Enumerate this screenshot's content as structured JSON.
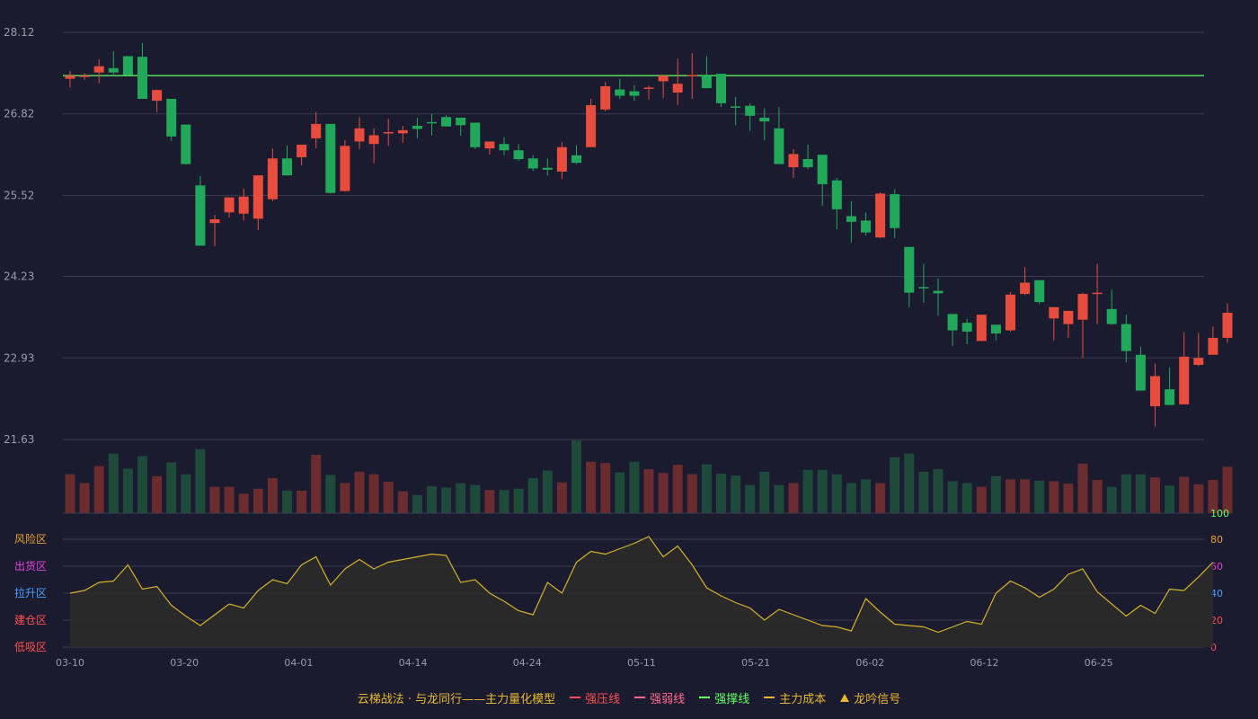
{
  "chart_data": [
    {
      "type": "candlestick",
      "y_axis_ticks": [
        "28.12",
        "26.82",
        "25.52",
        "24.23",
        "22.93",
        "21.63"
      ],
      "ylim": [
        21.63,
        28.12
      ],
      "resistance_line": 27.43,
      "date_ticks": [
        "03-10",
        "03-20",
        "04-01",
        "04-14",
        "04-24",
        "05-11",
        "05-21",
        "06-02",
        "06-12",
        "06-25"
      ],
      "ohlc": [
        [
          27.38,
          27.5,
          27.24,
          27.43
        ],
        [
          27.43,
          27.47,
          27.36,
          27.43
        ],
        [
          27.48,
          27.69,
          27.31,
          27.58
        ],
        [
          27.55,
          27.82,
          27.43,
          27.48
        ],
        [
          27.74,
          27.74,
          27.43,
          27.44
        ],
        [
          27.73,
          27.95,
          27.07,
          27.06
        ],
        [
          27.03,
          27.21,
          26.85,
          27.2
        ],
        [
          27.06,
          27.06,
          26.39,
          26.46
        ],
        [
          26.65,
          26.65,
          26.01,
          26.02
        ],
        [
          25.68,
          25.83,
          24.77,
          24.72
        ],
        [
          25.08,
          25.21,
          24.71,
          25.14
        ],
        [
          25.25,
          25.49,
          25.17,
          25.49
        ],
        [
          25.23,
          25.63,
          25.12,
          25.5
        ],
        [
          25.15,
          25.84,
          24.97,
          25.84
        ],
        [
          25.46,
          26.27,
          25.43,
          26.11
        ],
        [
          26.11,
          26.32,
          25.89,
          25.84
        ],
        [
          26.13,
          26.31,
          26.0,
          26.33
        ],
        [
          26.43,
          26.85,
          26.27,
          26.66
        ],
        [
          26.66,
          26.65,
          25.55,
          25.56
        ],
        [
          25.59,
          26.4,
          25.58,
          26.31
        ],
        [
          26.38,
          26.77,
          26.26,
          26.59
        ],
        [
          26.34,
          26.59,
          26.03,
          26.48
        ],
        [
          26.53,
          26.74,
          26.31,
          26.53
        ],
        [
          26.51,
          26.63,
          26.36,
          26.56
        ],
        [
          26.63,
          26.76,
          26.43,
          26.58
        ],
        [
          26.69,
          26.82,
          26.48,
          26.67
        ],
        [
          26.77,
          26.8,
          26.63,
          26.62
        ],
        [
          26.76,
          26.69,
          26.47,
          26.64
        ],
        [
          26.68,
          26.66,
          26.26,
          26.29
        ],
        [
          26.27,
          26.38,
          26.17,
          26.38
        ],
        [
          26.34,
          26.45,
          26.16,
          26.24
        ],
        [
          26.24,
          26.34,
          26.07,
          26.1
        ],
        [
          26.11,
          26.16,
          25.91,
          25.95
        ],
        [
          25.96,
          26.11,
          25.84,
          25.93
        ],
        [
          25.9,
          26.37,
          25.78,
          26.29
        ],
        [
          26.16,
          26.32,
          26.02,
          26.04
        ],
        [
          26.29,
          27.06,
          26.32,
          26.96
        ],
        [
          26.89,
          27.33,
          26.86,
          27.26
        ],
        [
          27.21,
          27.38,
          27.06,
          27.11
        ],
        [
          27.18,
          27.28,
          27.03,
          27.11
        ],
        [
          27.24,
          27.27,
          27.05,
          27.24
        ],
        [
          27.34,
          27.4,
          27.07,
          27.43
        ],
        [
          27.16,
          27.7,
          26.96,
          27.3
        ],
        [
          27.44,
          27.79,
          27.06,
          27.44
        ],
        [
          27.43,
          27.74,
          27.39,
          27.23
        ],
        [
          27.46,
          27.46,
          26.93,
          26.99
        ],
        [
          26.94,
          27.09,
          26.64,
          26.92
        ],
        [
          26.95,
          26.99,
          26.55,
          26.79
        ],
        [
          26.76,
          26.91,
          26.4,
          26.7
        ],
        [
          26.59,
          26.93,
          26.23,
          26.02
        ],
        [
          25.97,
          26.26,
          25.8,
          26.18
        ],
        [
          26.1,
          26.33,
          25.94,
          25.97
        ],
        [
          26.17,
          26.06,
          25.35,
          25.7
        ],
        [
          25.76,
          25.8,
          24.98,
          25.3
        ],
        [
          25.19,
          25.43,
          24.77,
          25.1
        ],
        [
          25.12,
          25.25,
          24.88,
          24.93
        ],
        [
          24.85,
          25.57,
          24.84,
          25.55
        ],
        [
          25.54,
          25.62,
          24.84,
          25.0
        ],
        [
          24.7,
          24.44,
          23.74,
          23.97
        ],
        [
          24.06,
          24.43,
          23.81,
          24.04
        ],
        [
          24.0,
          24.2,
          23.6,
          23.96
        ],
        [
          23.63,
          23.59,
          23.12,
          23.37
        ],
        [
          23.49,
          23.55,
          23.15,
          23.35
        ],
        [
          23.2,
          23.53,
          23.25,
          23.62
        ],
        [
          23.46,
          23.41,
          23.21,
          23.32
        ],
        [
          23.37,
          23.98,
          23.35,
          23.94
        ],
        [
          23.95,
          24.38,
          23.93,
          24.13
        ],
        [
          24.17,
          24.13,
          23.79,
          23.82
        ],
        [
          23.56,
          23.73,
          23.21,
          23.74
        ],
        [
          23.47,
          23.68,
          23.25,
          23.68
        ],
        [
          23.54,
          23.97,
          22.93,
          23.95
        ],
        [
          23.97,
          24.43,
          23.47,
          23.97
        ],
        [
          23.71,
          24.02,
          23.46,
          23.47
        ],
        [
          23.47,
          23.62,
          22.86,
          23.04
        ],
        [
          22.98,
          23.11,
          22.41,
          22.41
        ],
        [
          22.16,
          22.84,
          21.84,
          22.64
        ],
        [
          22.43,
          22.78,
          22.2,
          22.18
        ],
        [
          22.19,
          23.34,
          22.19,
          22.95
        ],
        [
          22.82,
          23.33,
          22.8,
          22.93
        ],
        [
          22.98,
          23.43,
          22.99,
          23.25
        ],
        [
          23.25,
          23.8,
          23.17,
          23.65
        ]
      ],
      "volume": [
        62,
        48,
        75,
        95,
        71,
        91,
        59,
        81,
        62,
        102,
        42,
        42,
        31,
        39,
        56,
        36,
        36,
        93,
        61,
        48,
        66,
        62,
        50,
        35,
        29,
        43,
        41,
        48,
        45,
        37,
        37,
        39,
        56,
        68,
        49,
        116,
        82,
        80,
        65,
        82,
        70,
        64,
        77,
        62,
        78,
        63,
        60,
        45,
        66,
        45,
        48,
        69,
        69,
        62,
        48,
        54,
        48,
        89,
        95,
        66,
        70,
        51,
        48,
        42,
        59,
        54,
        54,
        52,
        51,
        47,
        79,
        53,
        42,
        62,
        62,
        57,
        44,
        58,
        46,
        53,
        74
      ],
      "y_axis_right_top": "100"
    },
    {
      "type": "line",
      "zone_labels": [
        "风险区",
        "出货区",
        "拉升区",
        "建仓区",
        "低吸区"
      ],
      "zone_colors": [
        "#e8a030",
        "#e040e0",
        "#4a9fff",
        "#ff5050",
        "#ff5050"
      ],
      "y_ticks": [
        "80",
        "60",
        "40",
        "20",
        "0"
      ],
      "y_tick_colors": [
        "#e8a030",
        "#e040e0",
        "#4a9fff",
        "#ff5050",
        "#ff5050"
      ],
      "ylim": [
        0,
        80
      ],
      "values": [
        40,
        42,
        48,
        49,
        61,
        43,
        45,
        31,
        23,
        16,
        24,
        32,
        29,
        42,
        50,
        47,
        61,
        67,
        46,
        58,
        65,
        58,
        63,
        65,
        67,
        69,
        68,
        48,
        50,
        40,
        34,
        27,
        24,
        48,
        40,
        63,
        71,
        69,
        73,
        77,
        82,
        67,
        75,
        61,
        44,
        38,
        33,
        29,
        20,
        28,
        24,
        20,
        16,
        15,
        12,
        36,
        26,
        17,
        16,
        15,
        11,
        15,
        19,
        17,
        40,
        49,
        44,
        37,
        43,
        54,
        58,
        41,
        32,
        23,
        31,
        25,
        43,
        42,
        52,
        63
      ]
    }
  ],
  "legend": {
    "title": "云梯战法 · 与龙同行——主力量化模型",
    "title_color": "#e8b830",
    "items": [
      {
        "label": "强压线",
        "color": "#ff4d4d",
        "style": "solid"
      },
      {
        "label": "强弱线",
        "color": "#ff6b8a",
        "style": "dashed"
      },
      {
        "label": "强撑线",
        "color": "#66ff66",
        "style": "solid"
      },
      {
        "label": "主力成本",
        "color": "#e8b830",
        "style": "dashed"
      },
      {
        "label": "龙吟信号",
        "color": "#e8b830",
        "style": "triangle"
      }
    ]
  },
  "colors": {
    "background": "#1a1b2e",
    "up": "#e84c3d",
    "down": "#22a85a",
    "up_volume": "#6b2c30",
    "down_volume": "#1e4a3a",
    "grid": "#3a3b4e",
    "axis_text": "#9a9aa8",
    "resistance_line": "#66ff66",
    "indicator_line": "#d4b12a",
    "indicator_fill": "#2e2b28",
    "volume_axis_top": "#66ff66"
  }
}
